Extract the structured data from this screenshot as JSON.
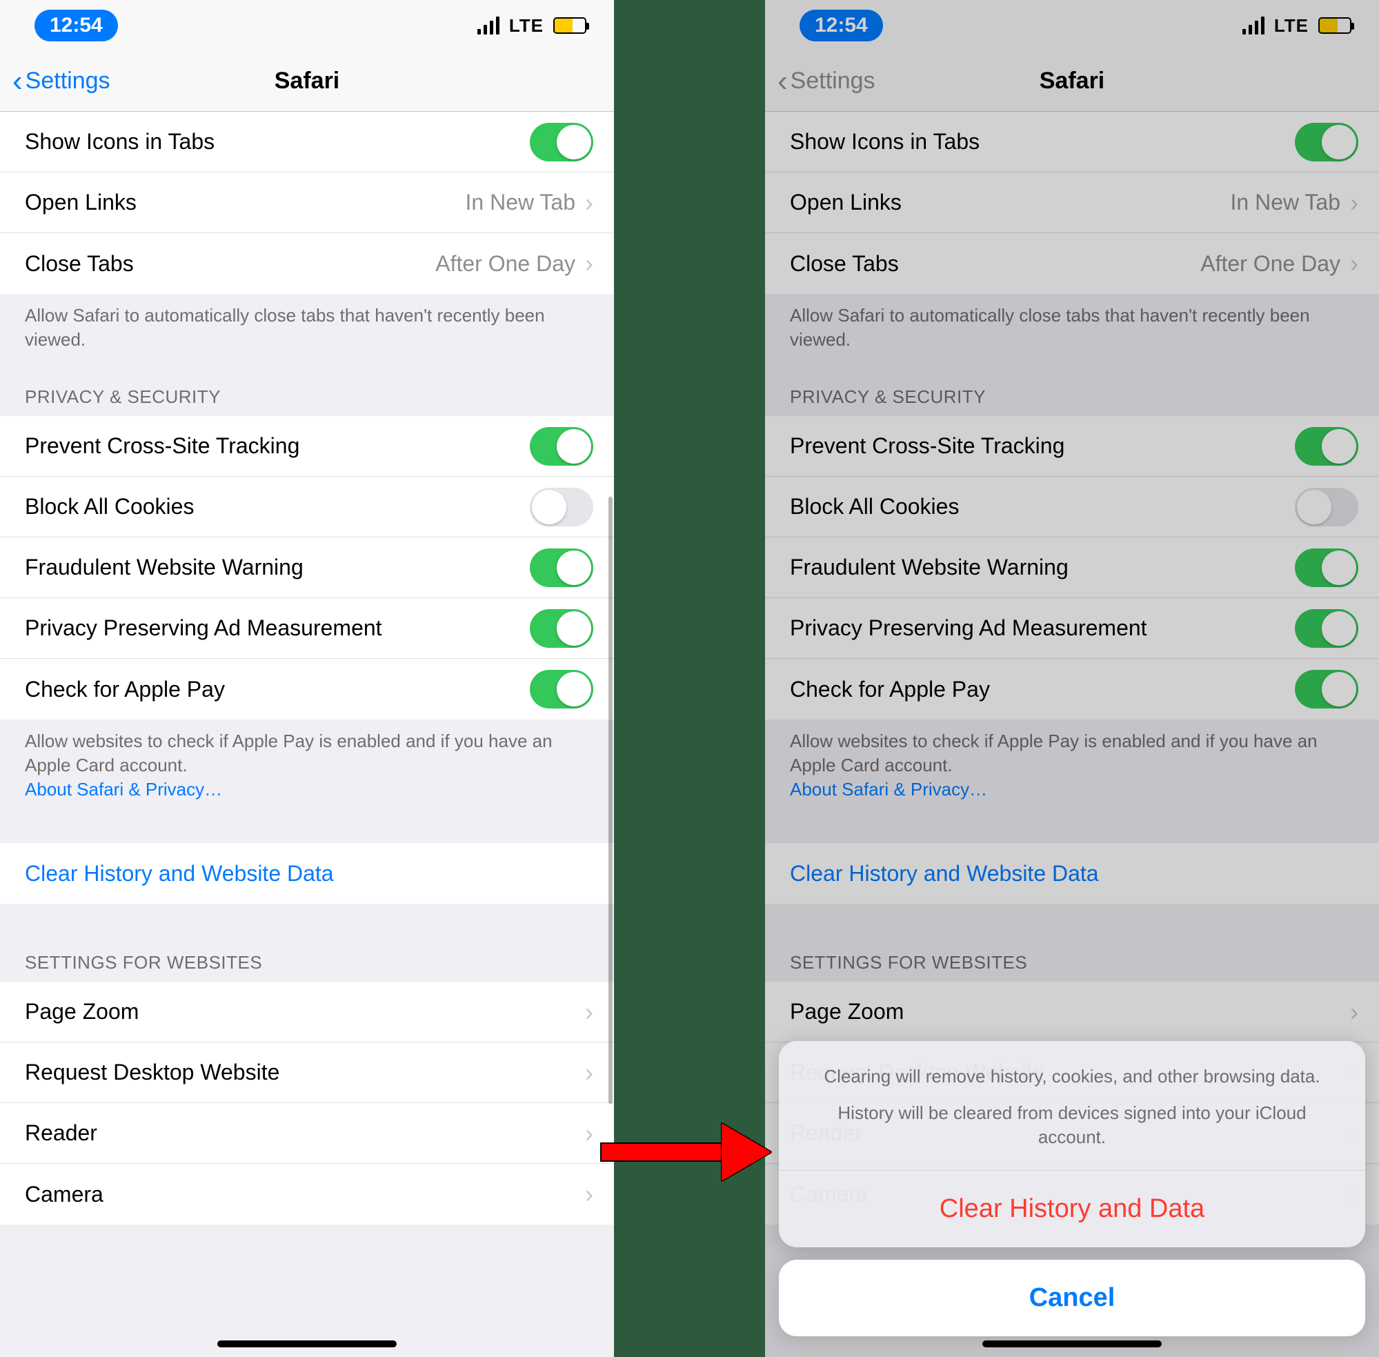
{
  "statusbar": {
    "time": "12:54",
    "net": "LTE"
  },
  "nav": {
    "back": "Settings",
    "title": "Safari"
  },
  "tabs_group": {
    "show_icons": "Show Icons in Tabs",
    "open_links_label": "Open Links",
    "open_links_value": "In New Tab",
    "close_tabs_label": "Close Tabs",
    "close_tabs_value": "After One Day",
    "footer": "Allow Safari to automatically close tabs that haven't recently been viewed."
  },
  "privacy": {
    "header": "Privacy & Security",
    "prevent_tracking": "Prevent Cross-Site Tracking",
    "block_cookies": "Block All Cookies",
    "fraud_warning": "Fraudulent Website Warning",
    "priv_ads": "Privacy Preserving Ad Measurement",
    "apple_pay": "Check for Apple Pay",
    "footer1": "Allow websites to check if Apple Pay is enabled and if you have an Apple Card account.",
    "footer2": "About Safari & Privacy…"
  },
  "clear_row": "Clear History and Website Data",
  "websites": {
    "header": "Settings for Websites",
    "page_zoom": "Page Zoom",
    "desktop": "Request Desktop Website",
    "reader": "Reader",
    "camera": "Camera"
  },
  "sheet": {
    "msg1": "Clearing will remove history, cookies, and other browsing data.",
    "msg2": "History will be cleared from devices signed into your iCloud account.",
    "action": "Clear History and Data",
    "cancel": "Cancel"
  }
}
